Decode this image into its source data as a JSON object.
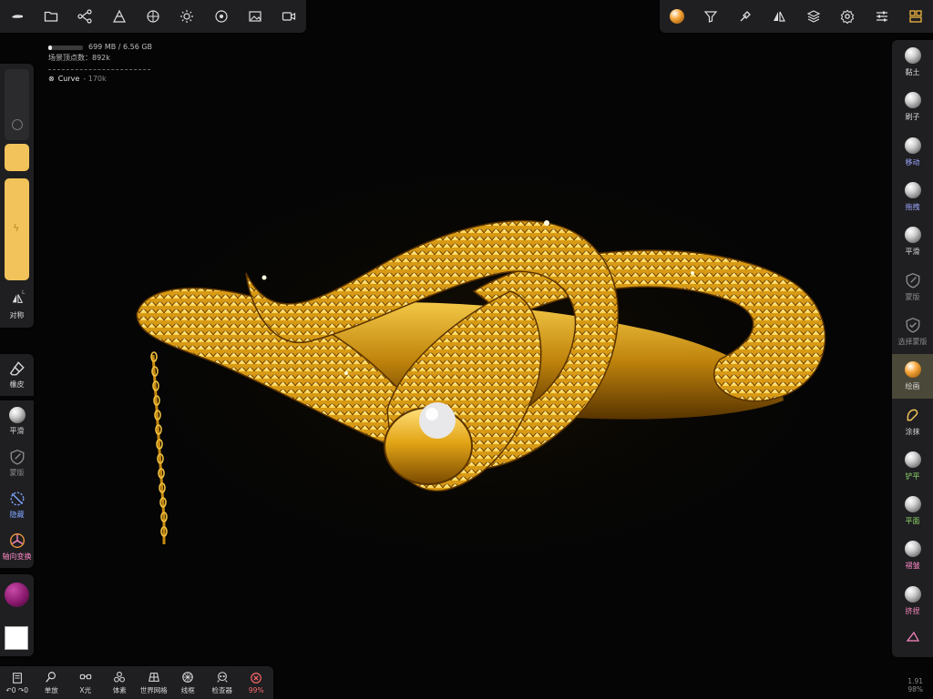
{
  "top_toolbar_left": {
    "icons": [
      "project-icon",
      "folder-icon",
      "scene-tree-icon",
      "topology-icon",
      "material-icon",
      "light-icon",
      "environment-icon",
      "image-icon",
      "camera-icon"
    ]
  },
  "top_toolbar_right": {
    "icons": [
      "matcap-icon",
      "filter-icon",
      "picker-icon",
      "symmetry-icon",
      "layers-icon",
      "settings-icon",
      "sliders-icon",
      "tools-icon"
    ]
  },
  "stats": {
    "memory": "699 MB / 6.56 GB",
    "memory_fraction": 0.11,
    "scene_vertices": "场景顶点数：892k",
    "object_name": "Curve",
    "object_count": " - 170k"
  },
  "left_slider": {
    "symmetry_label": "对称",
    "symmetry_badge": "L"
  },
  "left_tools": [
    {
      "name": "eraser",
      "label": "橡皮",
      "color": "#d8d8d8"
    },
    {
      "name": "smooth",
      "label": "平滑",
      "color": "#d8d8d8"
    },
    {
      "name": "mask",
      "label": "蒙版",
      "color": "#8c8c8c"
    },
    {
      "name": "hide",
      "label": "隐藏",
      "color": "#7fa6ff"
    },
    {
      "name": "gizmo",
      "label": "轴向变换",
      "color": "#ff8ac4"
    }
  ],
  "colors": {
    "material": "#8a1a6e",
    "secondary": "#ffffff"
  },
  "bottom_toolbar": [
    {
      "icon": "history-icon",
      "label": "↶0 ↷0"
    },
    {
      "icon": "zoom-icon",
      "label": "单放"
    },
    {
      "icon": "xray-icon",
      "label": "X光"
    },
    {
      "icon": "voxel-icon",
      "label": "体素"
    },
    {
      "icon": "grid-icon",
      "label": "世界网格"
    },
    {
      "icon": "wireframe-icon",
      "label": "线框"
    },
    {
      "icon": "inspector-icon",
      "label": "检查器"
    },
    {
      "icon": "close-circle-icon",
      "label": "99%"
    }
  ],
  "right_tools": [
    {
      "name": "clay",
      "label": "黏土",
      "color": "#d8d8d8"
    },
    {
      "name": "brush",
      "label": "刷子",
      "color": "#d8d8d8"
    },
    {
      "name": "move",
      "label": "移动",
      "color": "#9ea6ff"
    },
    {
      "name": "drag",
      "label": "拖拽",
      "color": "#9ea6ff"
    },
    {
      "name": "smooth",
      "label": "平滑",
      "color": "#d8d8d8"
    },
    {
      "name": "mask",
      "label": "蒙版",
      "color": "#8c8c8c"
    },
    {
      "name": "select-mask",
      "label": "选择蒙版",
      "color": "#8c8c8c"
    },
    {
      "name": "paint",
      "label": "绘画",
      "color": "#d8d8d8",
      "active": true
    },
    {
      "name": "smudge",
      "label": "涂抹",
      "color": "#d8d8d8"
    },
    {
      "name": "planar",
      "label": "铲平",
      "color": "#8fd96a"
    },
    {
      "name": "flatten",
      "label": "平面",
      "color": "#8fd96a"
    },
    {
      "name": "crease",
      "label": "褶皱",
      "color": "#ff8ac4"
    },
    {
      "name": "pinch",
      "label": "挤捏",
      "color": "#ff8ac4"
    }
  ],
  "corner": {
    "line1": "1.91",
    "line2": "98%"
  }
}
